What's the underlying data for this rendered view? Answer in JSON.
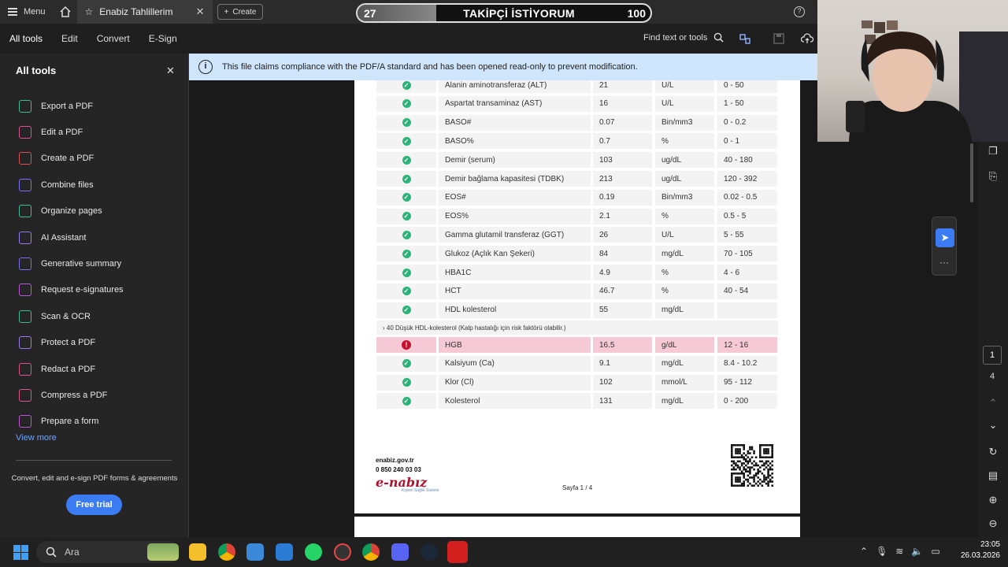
{
  "topbar": {
    "menu_label": "Menu",
    "tab_title": "Enabiz Tahlillerim",
    "create_label": "Create"
  },
  "overlay": {
    "left_count": "27",
    "text": "TAKİPÇİ İSTİYORUM",
    "right_count": "100",
    "progress": 0.27
  },
  "menubar": {
    "items": [
      "All tools",
      "Edit",
      "Convert",
      "E-Sign"
    ],
    "find_label": "Find text or tools"
  },
  "sidebar": {
    "title": "All tools",
    "items": [
      {
        "label": "Export a PDF",
        "color": "#3dbd9a"
      },
      {
        "label": "Edit a PDF",
        "color": "#e0508f"
      },
      {
        "label": "Create a PDF",
        "color": "#e05050"
      },
      {
        "label": "Combine files",
        "color": "#7b6cf0"
      },
      {
        "label": "Organize pages",
        "color": "#3dbd9a"
      },
      {
        "label": "AI Assistant",
        "color": "#9a7bf0"
      },
      {
        "label": "Generative summary",
        "color": "#7b6cf0"
      },
      {
        "label": "Request e-signatures",
        "color": "#c054d8"
      },
      {
        "label": "Scan & OCR",
        "color": "#3dbd9a"
      },
      {
        "label": "Protect a PDF",
        "color": "#9a7bf0"
      },
      {
        "label": "Redact a PDF",
        "color": "#e0508f"
      },
      {
        "label": "Compress a PDF",
        "color": "#e0508f"
      },
      {
        "label": "Prepare a form",
        "color": "#c054d8"
      }
    ],
    "view_more": "View more",
    "promo": "Convert, edit and e-sign PDF forms & agreements",
    "free_trial": "Free trial"
  },
  "infobar": {
    "text": "This file claims compliance with the PDF/A standard and has been opened read-only to prevent modification."
  },
  "results": [
    {
      "name": "Alanin aminotransferaz (ALT)",
      "value": "21",
      "unit": "U/L",
      "range": "0 - 50",
      "status": "ok"
    },
    {
      "name": "Aspartat transaminaz (AST)",
      "value": "16",
      "unit": "U/L",
      "range": "1 - 50",
      "status": "ok"
    },
    {
      "name": "BASO#",
      "value": "0.07",
      "unit": "Bin/mm3",
      "range": "0 - 0.2",
      "status": "ok"
    },
    {
      "name": "BASO%",
      "value": "0.7",
      "unit": "%",
      "range": "0 - 1",
      "status": "ok"
    },
    {
      "name": "Demir (serum)",
      "value": "103",
      "unit": "ug/dL",
      "range": "40 - 180",
      "status": "ok"
    },
    {
      "name": "Demir bağlama kapasitesi (TDBK)",
      "value": "213",
      "unit": "ug/dL",
      "range": "120 - 392",
      "status": "ok"
    },
    {
      "name": "EOS#",
      "value": "0.19",
      "unit": "Bin/mm3",
      "range": "0.02 - 0.5",
      "status": "ok"
    },
    {
      "name": "EOS%",
      "value": "2.1",
      "unit": "%",
      "range": "0.5 - 5",
      "status": "ok"
    },
    {
      "name": "Gamma glutamil transferaz (GGT)",
      "value": "26",
      "unit": "U/L",
      "range": "5 - 55",
      "status": "ok"
    },
    {
      "name": "Glukoz (Açlık Kan Şekeri)",
      "value": "84",
      "unit": "mg/dL",
      "range": "70 - 105",
      "status": "ok"
    },
    {
      "name": "HBA1C",
      "value": "4.9",
      "unit": "%",
      "range": "4 - 6",
      "status": "ok"
    },
    {
      "name": "HCT",
      "value": "46.7",
      "unit": "%",
      "range": "40 - 54",
      "status": "ok"
    },
    {
      "name": "HDL kolesterol",
      "value": "55",
      "unit": "mg/dL",
      "range": "",
      "status": "ok"
    }
  ],
  "note": "› 40 Düşük HDL-kolesterol (Kalp hastalığı için risk faktörü olabilir.)",
  "results_after": [
    {
      "name": "HGB",
      "value": "16.5",
      "unit": "g/dL",
      "range": "12 - 16",
      "status": "alert"
    },
    {
      "name": "Kalsiyum (Ca)",
      "value": "9.1",
      "unit": "mg/dL",
      "range": "8.4 - 10.2",
      "status": "ok"
    },
    {
      "name": "Klor (Cl)",
      "value": "102",
      "unit": "mmol/L",
      "range": "95 - 112",
      "status": "ok"
    },
    {
      "name": "Kolesterol",
      "value": "131",
      "unit": "mg/dL",
      "range": "0 - 200",
      "status": "ok"
    }
  ],
  "footer": {
    "site": "enabiz.gov.tr",
    "phone": "0 850 240 03 03",
    "logo": "e-nabız",
    "logo_sub": "Kişisel Sağlık Sistemi",
    "page": "Sayfa 1 / 4"
  },
  "pager": {
    "current": "1",
    "total": "4"
  },
  "taskbar": {
    "search_placeholder": "Ara",
    "time": "23:05",
    "date": "26.03.2026"
  }
}
